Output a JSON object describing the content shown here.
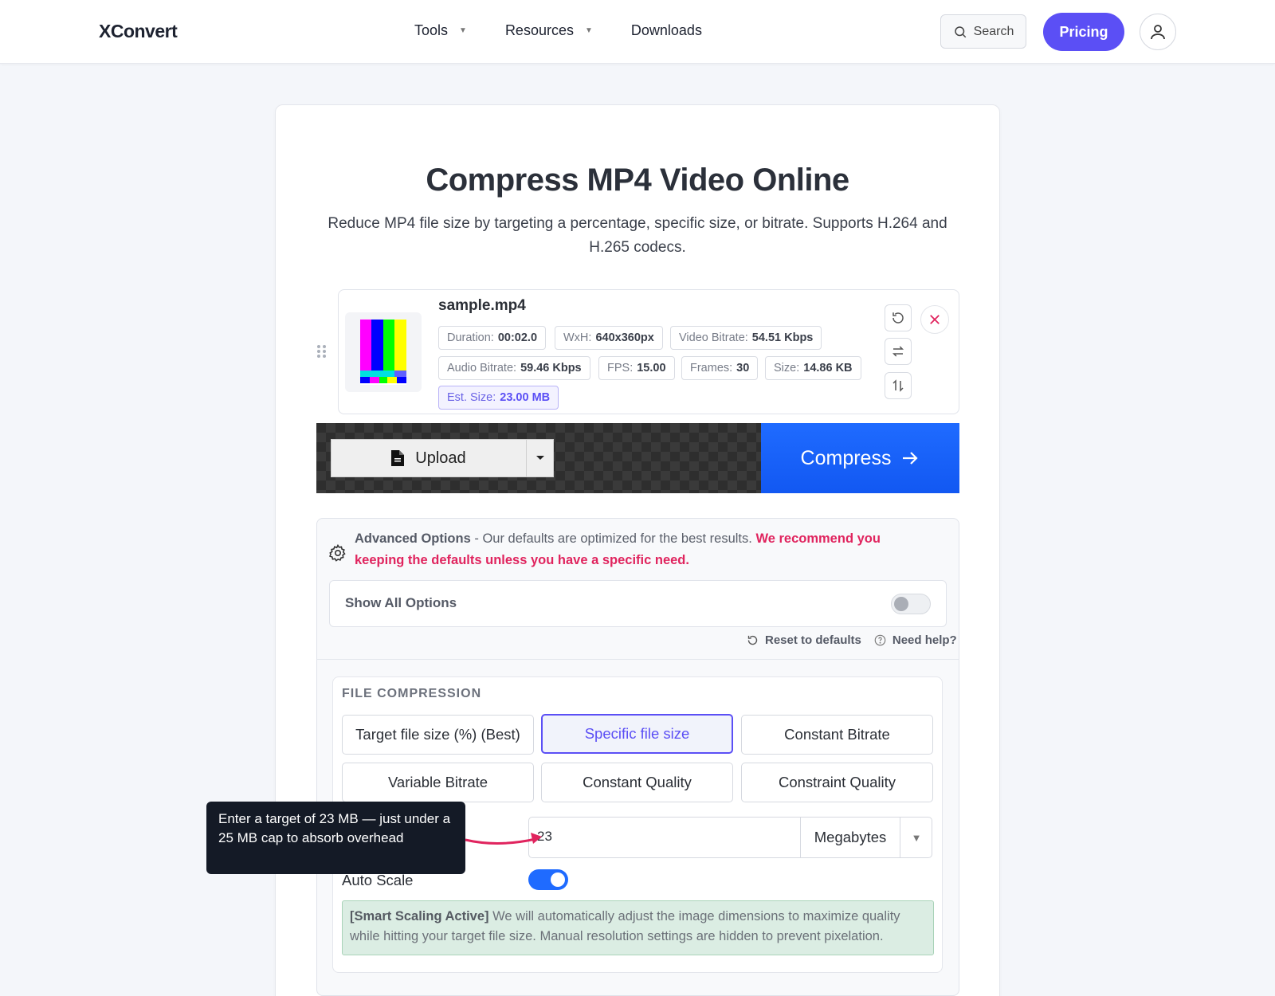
{
  "header": {
    "logo": "XConvert",
    "nav": [
      {
        "label": "Tools",
        "has_dropdown": true
      },
      {
        "label": "Resources",
        "has_dropdown": true
      },
      {
        "label": "Downloads",
        "has_dropdown": false
      }
    ],
    "search_label": "Search",
    "pricing_label": "Pricing",
    "accent_color": "#5b4ff5"
  },
  "page": {
    "title": "Compress MP4 Video Online",
    "subtitle": "Reduce MP4 file size by targeting a percentage, specific size, or bitrate. Supports H.264 and H.265 codecs."
  },
  "file": {
    "name": "sample.mp4",
    "meta": [
      {
        "label": "Duration:",
        "value": "00:02.0"
      },
      {
        "label": "WxH:",
        "value": "640x360px"
      },
      {
        "label": "Video Bitrate:",
        "value": "54.51 Kbps"
      },
      {
        "label": "Audio Bitrate:",
        "value": "59.46 Kbps"
      },
      {
        "label": "FPS:",
        "value": "15.00"
      },
      {
        "label": "Frames:",
        "value": "30"
      },
      {
        "label": "Size:",
        "value": "14.86 KB"
      },
      {
        "label": "Est. Size:",
        "value": "23.00 MB"
      }
    ]
  },
  "actions": {
    "upload_label": "Upload",
    "compress_label": "Compress",
    "compress_color": "#1f6bff"
  },
  "advanced": {
    "title": "Advanced Options",
    "description": " - Our defaults are optimized for the best results. ",
    "warning": "We recommend you keeping the defaults unless you have a specific need.",
    "show_all_label": "Show All Options",
    "show_all_enabled": false,
    "reset_label": "Reset to defaults",
    "help_label": "Need help?"
  },
  "compression": {
    "section_title": "FILE COMPRESSION",
    "options": [
      {
        "label": "Target file size (%) (Best)",
        "active": false
      },
      {
        "label": "Specific file size",
        "active": true
      },
      {
        "label": "Constant Bitrate",
        "active": false
      },
      {
        "label": "Variable Bitrate",
        "active": false
      },
      {
        "label": "Constant Quality",
        "active": false
      },
      {
        "label": "Constraint Quality",
        "active": false
      }
    ],
    "size_value": "23",
    "unit": "Megabytes",
    "auto_scale_label": "Auto Scale",
    "auto_scale_enabled": true,
    "smart_title": "[Smart Scaling Active]",
    "smart_text": " We will automatically adjust the image dimensions to maximize quality while hitting your target file size. Manual resolution settings are hidden to prevent pixelation."
  },
  "callout": {
    "text": "Enter a target of 23 MB — just under a 25 MB cap to absorb overhead",
    "arrow_color": "#e0245e"
  }
}
